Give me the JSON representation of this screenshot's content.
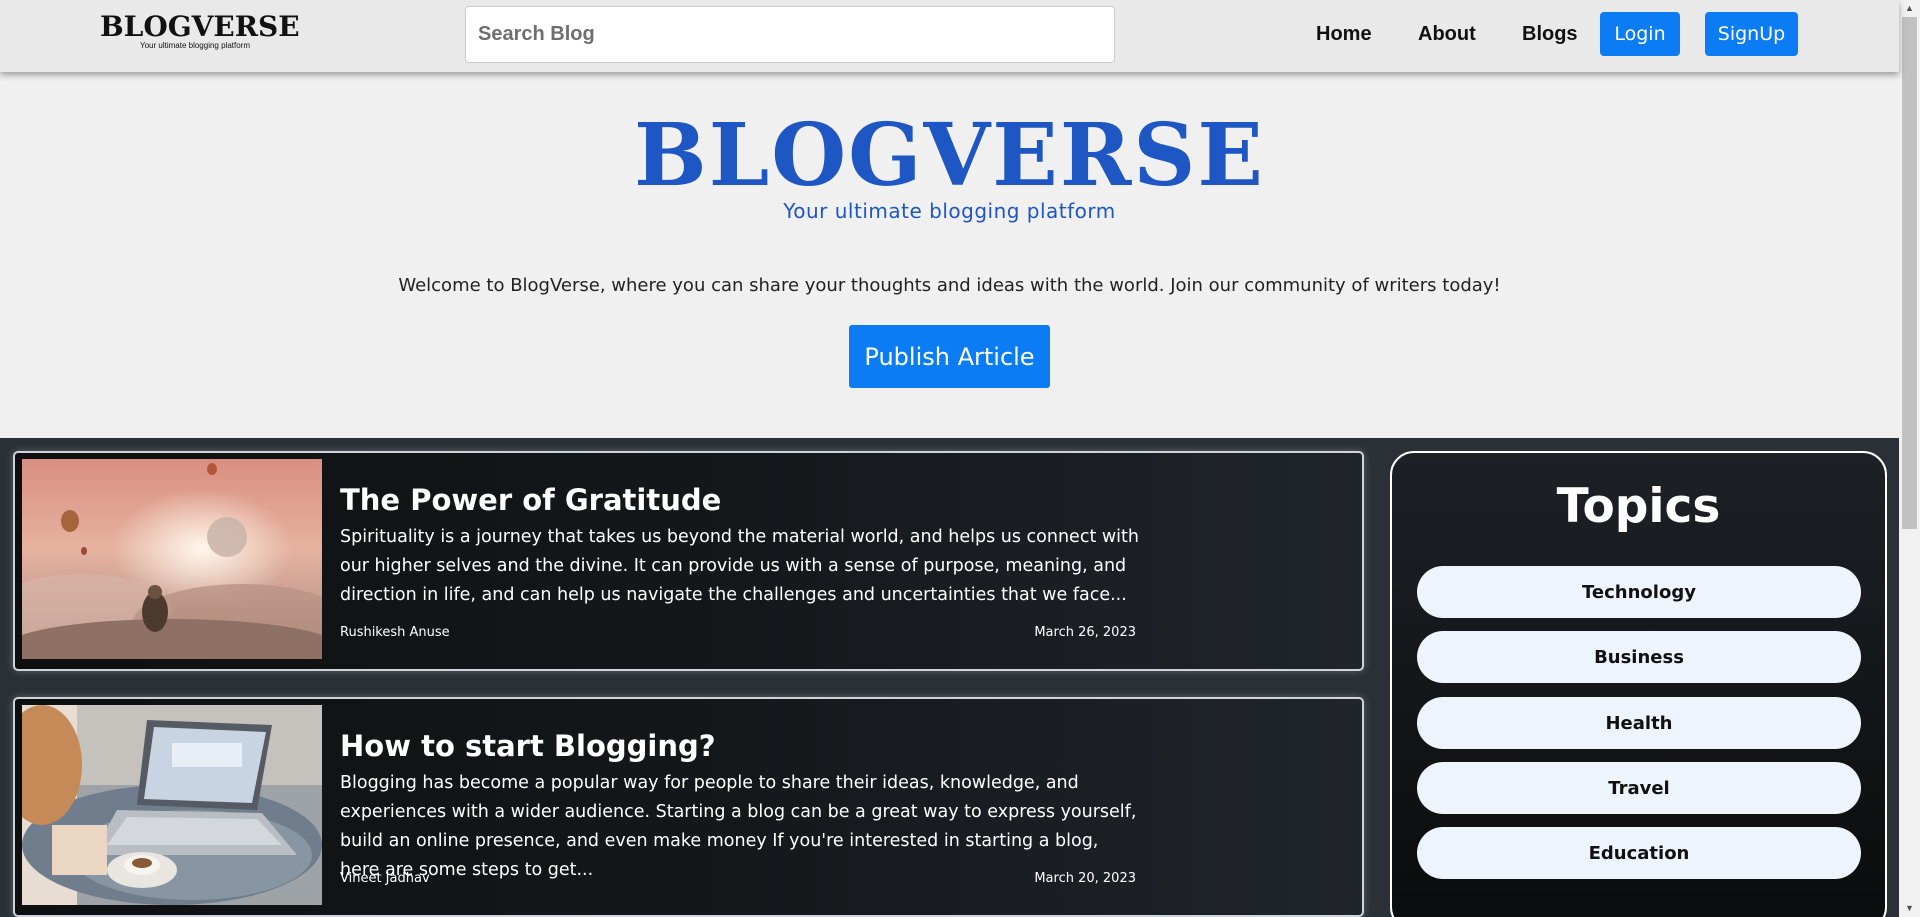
{
  "navbar": {
    "logo_title": "BLOGVERSE",
    "logo_tagline": "Your ultimate blogging platform",
    "search_placeholder": "Search Blog",
    "links": {
      "home": "Home",
      "about": "About",
      "blogs": "Blogs"
    },
    "login_label": "Login",
    "signup_label": "SignUp"
  },
  "hero": {
    "title": "BLOGVERSE",
    "subtitle": "Your ultimate blogging platform",
    "welcome": "Welcome to BlogVerse, where you can share your thoughts and ideas with the world. Join our community of writers today!",
    "publish_label": "Publish Article"
  },
  "blogs": [
    {
      "title": "The Power of Gratitude",
      "excerpt": "Spirituality is a journey that takes us beyond the material world, and helps us connect with our higher selves and the divine. It can provide us with a sense of purpose, meaning, and direction in life, and can help us navigate the challenges and uncertainties that we face...",
      "author": "Rushikesh Anuse",
      "date": "March 26, 2023",
      "image": "gratitude-image"
    },
    {
      "title": "How to start Blogging?",
      "excerpt": "Blogging has become a popular way for people to share their ideas, knowledge, and experiences with a wider audience. Starting a blog can be a great way to express yourself, build an online presence, and even make money If you're interested in starting a blog, here are some steps to get...",
      "author": "Vineet Jadhav",
      "date": "March 20, 2023",
      "image": "blogging-image"
    }
  ],
  "topics": {
    "title": "Topics",
    "items": [
      "Technology",
      "Business",
      "Health",
      "Travel",
      "Education"
    ]
  },
  "colors": {
    "brand_blue": "#1e56c4",
    "button_blue": "#0b7cf4",
    "content_bg": "#2b3036",
    "topic_pill": "#eef4fb"
  }
}
